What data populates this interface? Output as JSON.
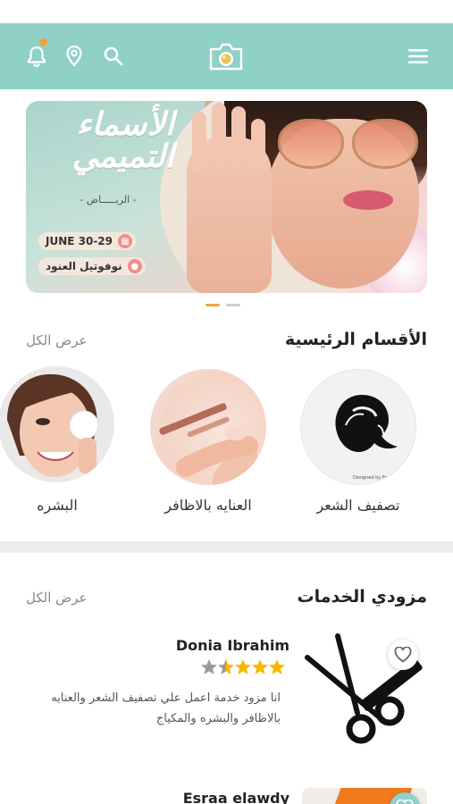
{
  "header": {
    "bell_icon": "bell-icon",
    "location_icon": "location-pin-icon",
    "search_icon": "search-icon",
    "logo_icon": "camera-logo-icon",
    "menu_icon": "hamburger-menu-icon",
    "colors": {
      "bar": "#8fd0c7",
      "badge": "#f0a23b"
    }
  },
  "banner": {
    "title": "الأسماء التميمي",
    "city": "- الريـــــاض -",
    "date": "JUNE 30-29",
    "venue": "نوفوتيل العنود",
    "date_icon": "calendar-icon",
    "venue_icon": "location-pin-icon"
  },
  "carousel": {
    "count": 2,
    "active_index": 0,
    "active_color": "#f0a23b",
    "inactive_color": "#cfcfcf"
  },
  "categories": {
    "title": "الأقسام الرئيسية",
    "see_all": "عرض الكل",
    "items": [
      {
        "label": "تصفيف الشعر",
        "image": "hair-silhouette-illustration",
        "caption": "Designed by Freepik"
      },
      {
        "label": "العنايه بالاظافر",
        "image": "nail-care-photo"
      },
      {
        "label": "البشره",
        "image": "skin-care-photo"
      }
    ]
  },
  "providers": {
    "title": "مزودي الخدمات",
    "see_all": "عرض الكل",
    "items": [
      {
        "name": "Donia Ibrahim",
        "rating_out_of_5": 4.5,
        "description": "انا مزود خدمة اعمل علي تصفيف الشعر والعنايه بالاظافر والبشره والمكياج",
        "image": "scissors-comb-icon",
        "favorite_icon": "heart-icon"
      },
      {
        "name": "Esraa elawdy",
        "image": "orange-thumbnail",
        "favorite_icon": "heart-icon"
      }
    ],
    "star_color": "#f6b800",
    "star_empty_color": "#9a9a9a"
  }
}
